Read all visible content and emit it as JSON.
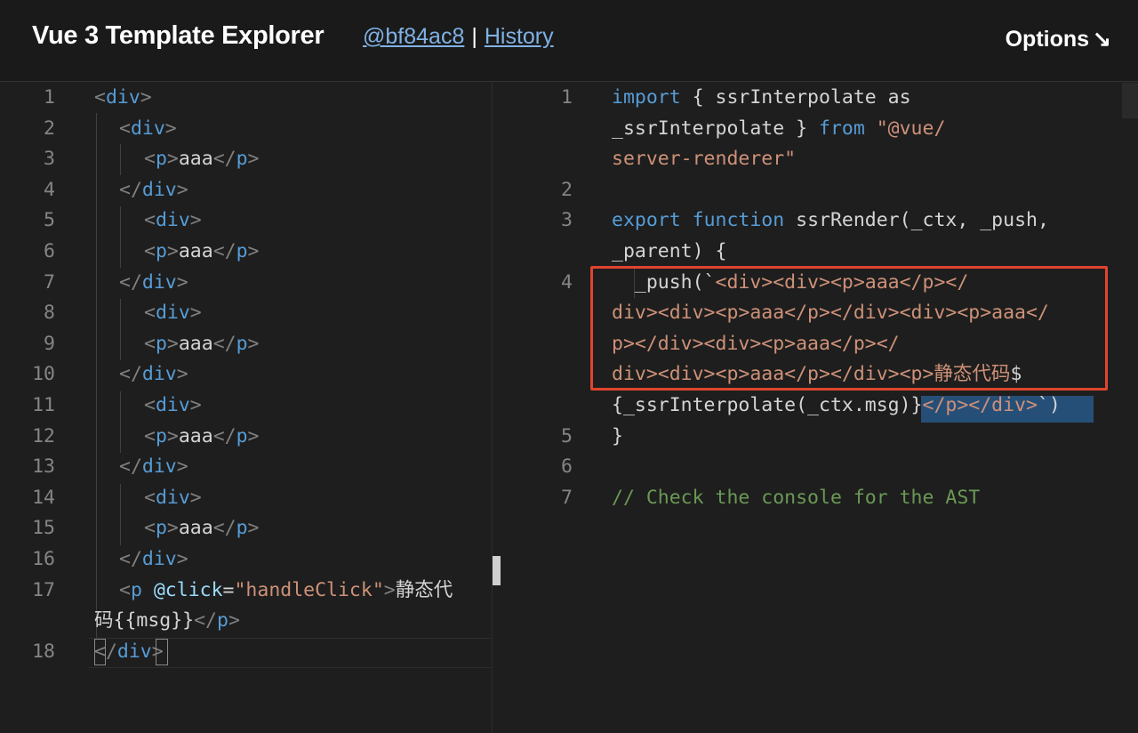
{
  "header": {
    "title": "Vue 3 Template Explorer",
    "commit_link": "@bf84ac8",
    "separator": "|",
    "history_link": "History",
    "options_label": "Options",
    "options_icon": "↘"
  },
  "left_editor": {
    "line_numbers": [
      "1",
      "2",
      "3",
      "4",
      "5",
      "6",
      "7",
      "8",
      "9",
      "10",
      "11",
      "12",
      "13",
      "14",
      "15",
      "16",
      "17",
      "",
      "18"
    ],
    "l1_tag": "div",
    "l2_tag": "div",
    "l3_tag": "p",
    "l3_text": "aaa",
    "l3_close": "p",
    "l4_close": "div",
    "l5_tag": "div",
    "l6_tag": "p",
    "l6_text": "aaa",
    "l6_close": "p",
    "l7_close": "div",
    "l8_tag": "div",
    "l9_tag": "p",
    "l9_text": "aaa",
    "l9_close": "p",
    "l10_close": "div",
    "l11_tag": "div",
    "l12_tag": "p",
    "l12_text": "aaa",
    "l12_close": "p",
    "l13_close": "div",
    "l14_tag": "div",
    "l15_tag": "p",
    "l15_text": "aaa",
    "l15_close": "p",
    "l16_close": "div",
    "l17_tag": "p",
    "l17_attr": "@click",
    "l17_value": "\"handleClick\"",
    "l17_text": "静态代",
    "l17b_text": "码{{msg}}",
    "l17b_close": "p",
    "l18_close": "div"
  },
  "right_editor": {
    "line_numbers": [
      "1",
      "",
      "",
      "2",
      "3",
      "",
      "4",
      "",
      "",
      "",
      "",
      "5",
      "6",
      "7"
    ],
    "r1_kw": "import",
    "r1_rest": " { ssrInterpolate as",
    "r1b": "_ssrInterpolate } ",
    "r1b_kw": "from",
    "r1b_str": " \"@vue/",
    "r1c_str": "server-renderer\"",
    "r3_kw1": "export",
    "r3_kw2": "function",
    "r3_rest": " ssrRender(_ctx, _push,",
    "r3b": "_parent) {",
    "r4_fn": "  _push(`",
    "r4_str": "<div><div><p>aaa</p></",
    "r4b_str": "div><div><p>aaa</p></div><div><p>aaa</",
    "r4c_str": "p></div><div><p>aaa</p></",
    "r4d_str": "div><div><p>aaa</p></div><p>静态代码",
    "r4d_tail": "$",
    "r4e_text": "{_ssrInterpolate(_ctx.msg)}",
    "r4e_str": "</p></div>",
    "r4e_tail": "`)",
    "r5": "}",
    "r7_comment": "// Check the console for the AST"
  },
  "colors": {
    "tag": "#569cd6",
    "string": "#ce9178",
    "keyword": "#569cd6",
    "comment": "#6a9955",
    "attribute": "#9cdcfe",
    "highlight_box": "#e0442e"
  }
}
